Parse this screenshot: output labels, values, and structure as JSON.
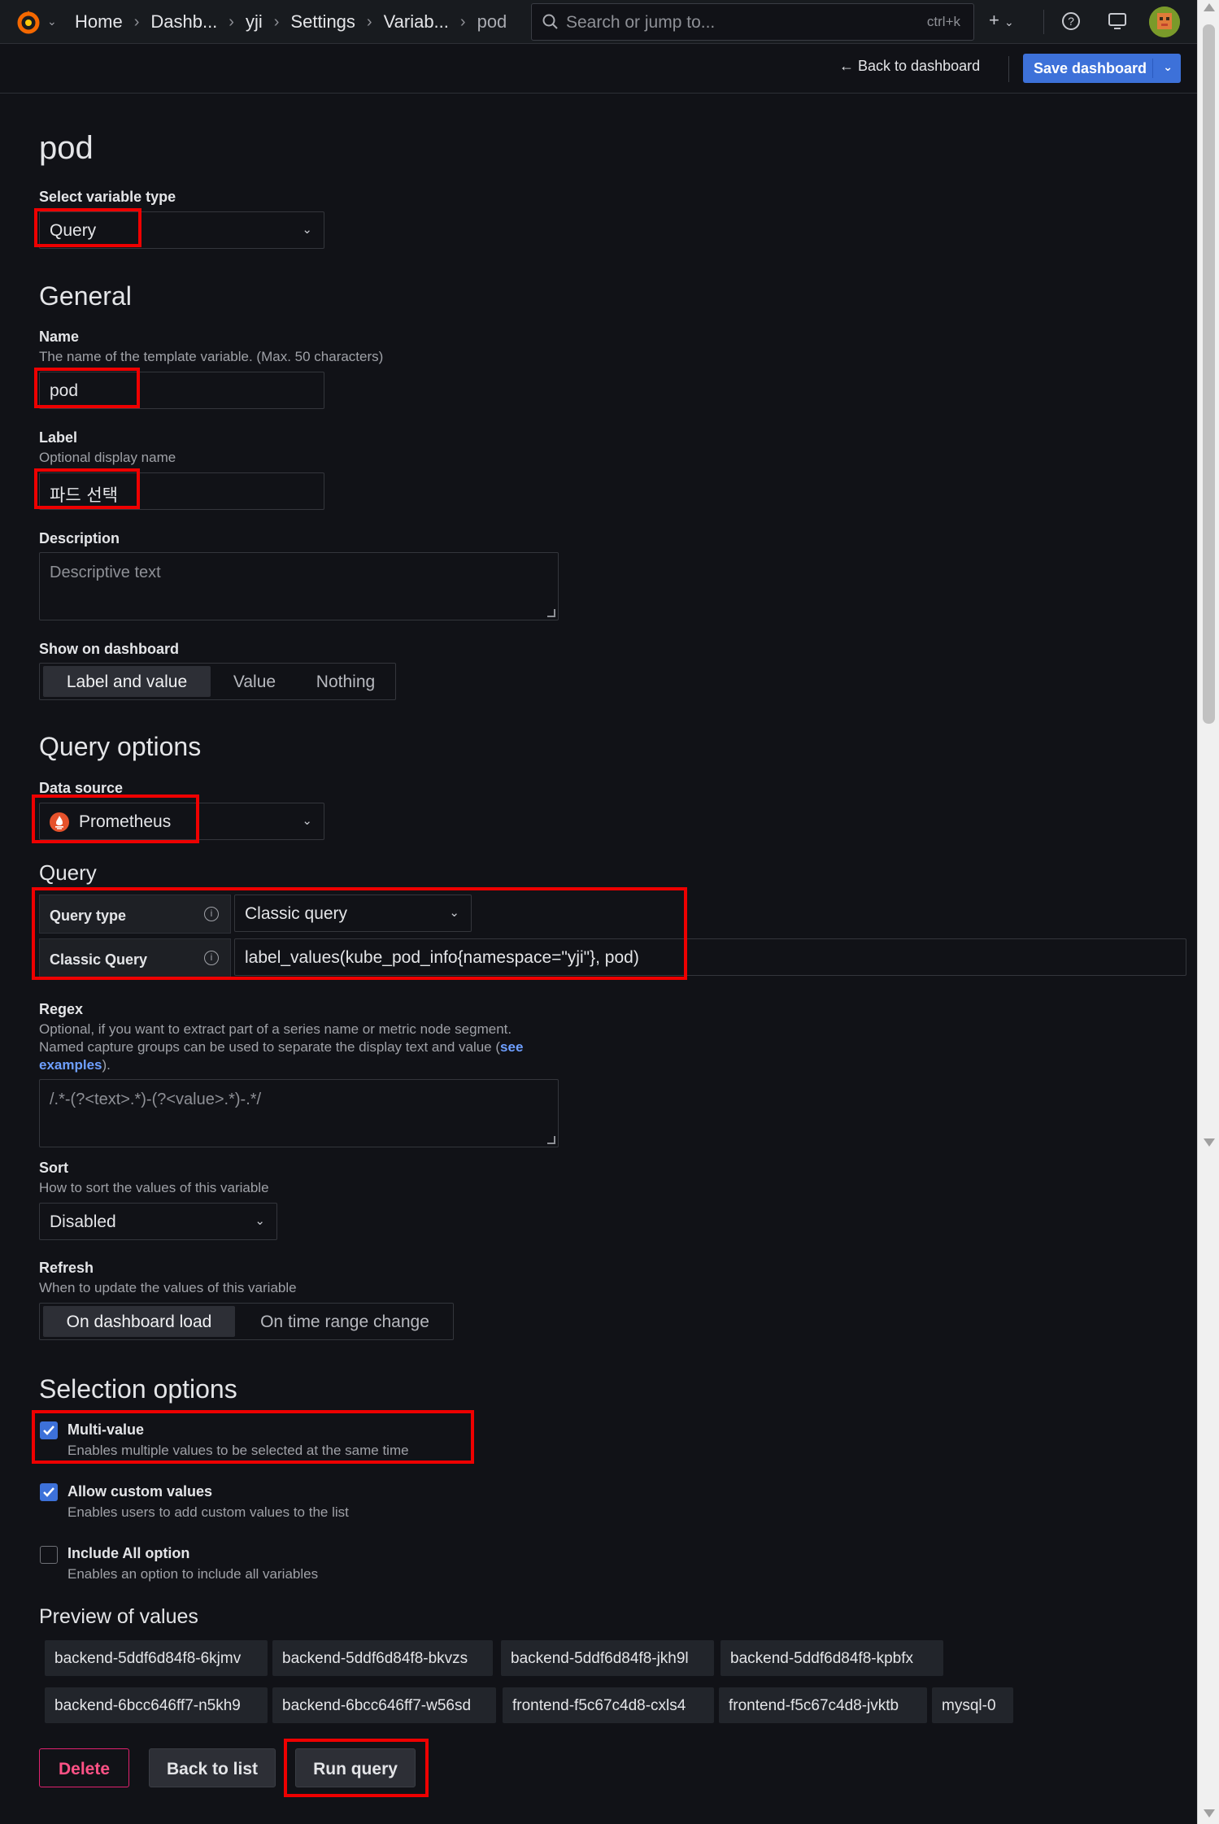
{
  "topbar": {
    "breadcrumbs": [
      "Home",
      "Dashb...",
      "yji",
      "Settings",
      "Variab...",
      "pod"
    ],
    "search_placeholder": "Search or jump to...",
    "search_shortcut": "ctrl+k",
    "add_label": "+"
  },
  "subbar": {
    "back_label": "Back to dashboard",
    "save_label": "Save dashboard"
  },
  "page": {
    "title": "pod",
    "variable_type_label": "Select variable type",
    "variable_type_value": "Query"
  },
  "general": {
    "heading": "General",
    "name_label": "Name",
    "name_desc": "The name of the template variable. (Max. 50 characters)",
    "name_value": "pod",
    "label_label": "Label",
    "label_desc": "Optional display name",
    "label_value": "파드 선택",
    "description_label": "Description",
    "description_placeholder": "Descriptive text",
    "show_label": "Show on dashboard",
    "show_options": [
      "Label and value",
      "Value",
      "Nothing"
    ],
    "show_selected": "Label and value"
  },
  "query_options": {
    "heading": "Query options",
    "datasource_label": "Data source",
    "datasource_value": "Prometheus",
    "query_heading": "Query",
    "query_type_label": "Query type",
    "query_type_value": "Classic query",
    "classic_query_label": "Classic Query",
    "classic_query_value": "label_values(kube_pod_info{namespace=\"yji\"}, pod)",
    "regex_label": "Regex",
    "regex_desc_1": "Optional, if you want to extract part of a series name or metric node segment.",
    "regex_desc_2": "Named capture groups can be used to separate the display text and value (",
    "regex_link_1": "see",
    "regex_link_2": "examples",
    "regex_desc_end": ").",
    "regex_placeholder": "/.*-(?<text>.*)-(?<value>.*)-.*/",
    "sort_label": "Sort",
    "sort_desc": "How to sort the values of this variable",
    "sort_value": "Disabled",
    "refresh_label": "Refresh",
    "refresh_desc": "When to update the values of this variable",
    "refresh_options": [
      "On dashboard load",
      "On time range change"
    ],
    "refresh_selected": "On dashboard load"
  },
  "selection": {
    "heading": "Selection options",
    "multi_label": "Multi-value",
    "multi_desc": "Enables multiple values to be selected at the same time",
    "multi_checked": true,
    "custom_label": "Allow custom values",
    "custom_desc": "Enables users to add custom values to the list",
    "custom_checked": true,
    "all_label": "Include All option",
    "all_desc": "Enables an option to include all variables",
    "all_checked": false
  },
  "preview": {
    "heading": "Preview of values",
    "values": [
      "backend-5ddf6d84f8-6kjmv",
      "backend-5ddf6d84f8-bkvzs",
      "backend-5ddf6d84f8-jkh9l",
      "backend-5ddf6d84f8-kpbfx",
      "backend-6bcc646ff7-n5kh9",
      "backend-6bcc646ff7-w56sd",
      "frontend-f5c67c4d8-cxls4",
      "frontend-f5c67c4d8-jvktb",
      "mysql-0"
    ]
  },
  "actions": {
    "delete_label": "Delete",
    "back_label": "Back to list",
    "run_label": "Run query"
  },
  "colors": {
    "accent": "#3d71d9",
    "highlight": "#ee0000",
    "danger": "#ff5286"
  }
}
